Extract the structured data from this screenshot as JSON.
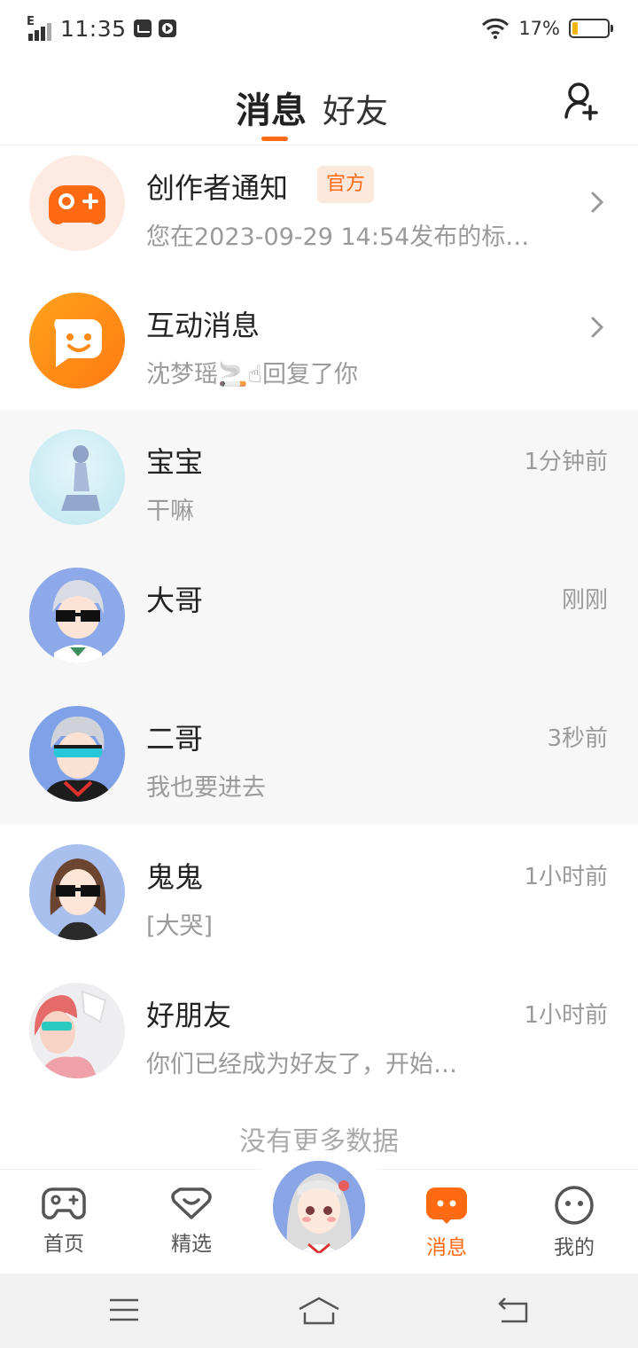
{
  "status_bar": {
    "network": "E",
    "time": "11:35",
    "battery_percent": "17%",
    "battery_level": 0.17,
    "icons": [
      "signal-icon",
      "mail-icon",
      "play-icon",
      "wifi-icon",
      "battery-icon"
    ]
  },
  "header": {
    "tab_messages": "消息",
    "tab_friends": "好友",
    "add_friend_icon": "add-user-icon"
  },
  "colors": {
    "accent": "#ff6a13",
    "badge_bg": "#fde9dc",
    "muted_text": "#9a9a9a",
    "shaded_row": "#f7f7f8"
  },
  "system_items": [
    {
      "name": "创作者通知",
      "badge": "官方",
      "preview": "您在2023-09-29 14:54发布的标…",
      "icon": "gamepad-icon"
    },
    {
      "name": "互动消息",
      "preview": "沈梦瑶🚬☝回复了你",
      "icon": "chat-bubble-icon"
    }
  ],
  "conversations": [
    {
      "name": "宝宝",
      "time": "1分钟前",
      "preview": "干嘛",
      "shaded": true
    },
    {
      "name": "大哥",
      "time": "刚刚",
      "preview": "",
      "shaded": true
    },
    {
      "name": "二哥",
      "time": "3秒前",
      "preview": "我也要进去",
      "shaded": true
    },
    {
      "name": "鬼鬼",
      "time": "1小时前",
      "preview": "[大哭]",
      "shaded": false
    },
    {
      "name": "好朋友",
      "time": "1小时前",
      "preview": "你们已经成为好友了，开始…",
      "shaded": false
    }
  ],
  "list_footer": "没有更多数据",
  "bottom_nav": {
    "home": "首页",
    "featured": "精选",
    "messages": "消息",
    "mine": "我的",
    "active": "messages"
  },
  "system_nav": [
    "menu-icon",
    "home-icon",
    "back-icon"
  ]
}
